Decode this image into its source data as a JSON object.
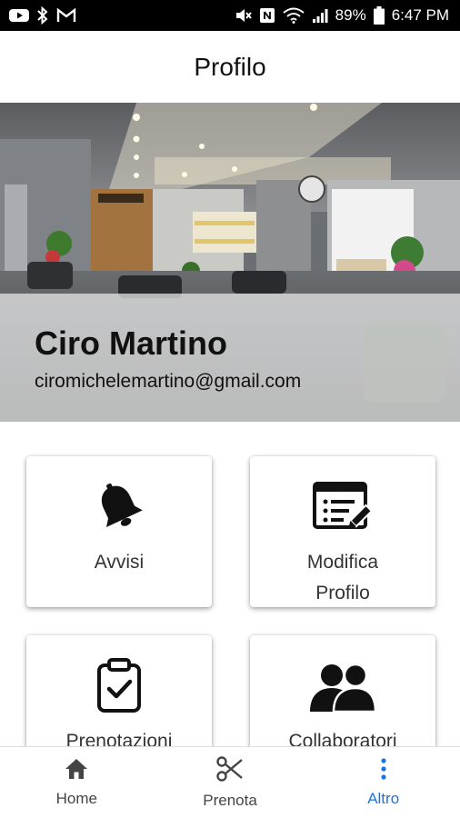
{
  "status_bar": {
    "battery": "89%",
    "time": "6:47 PM",
    "left_icons": [
      "youtube-icon",
      "bluetooth-icon",
      "gmail-icon"
    ],
    "right_icons": [
      "mute-icon",
      "nfc-icon",
      "wifi-icon",
      "signal-icon",
      "battery-icon"
    ]
  },
  "app_bar": {
    "title": "Profilo"
  },
  "profile": {
    "name": "Ciro Martino",
    "email": "ciromichelemartino@gmail.com",
    "hero_sign": "Le Barbier"
  },
  "menu": [
    {
      "label_line1": "Avvisi",
      "label_line2": "",
      "icon": "bell-icon"
    },
    {
      "label_line1": "Modifica",
      "label_line2": "Profilo",
      "icon": "edit-profile-icon"
    },
    {
      "label_line1": "Prenotazioni",
      "label_line2": "",
      "icon": "clipboard-check-icon"
    },
    {
      "label_line1": "Collaboratori",
      "label_line2": "",
      "icon": "people-icon"
    }
  ],
  "bottom_nav": [
    {
      "label": "Home",
      "icon": "home-icon",
      "active": false
    },
    {
      "label": "Prenota",
      "icon": "scissors-icon",
      "active": false
    },
    {
      "label": "Altro",
      "icon": "more-vert-icon",
      "active": true
    }
  ],
  "colors": {
    "active": "#1a73e8",
    "status_bar": "#000000",
    "text": "#111111"
  }
}
